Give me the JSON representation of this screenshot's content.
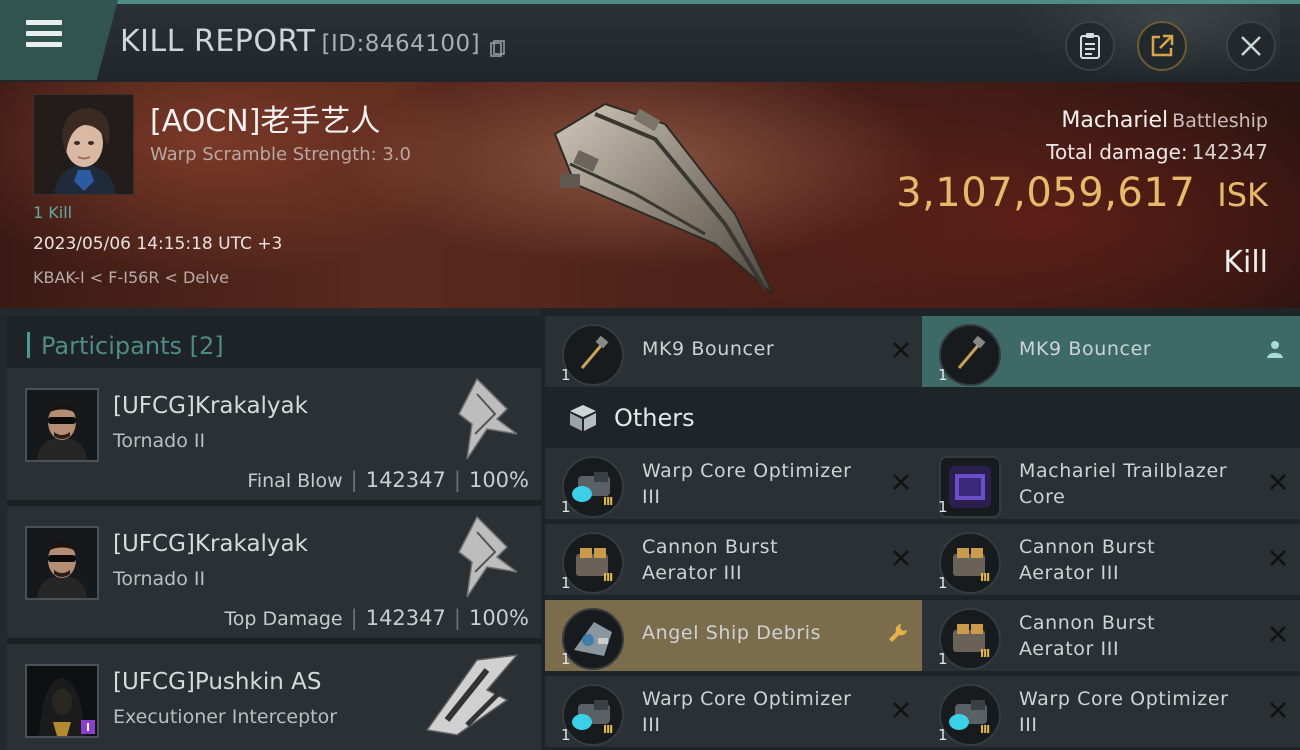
{
  "header": {
    "title": "KILL REPORT",
    "report_id": "[ID:8464100]"
  },
  "victim": {
    "name": "[AOCN]老手艺人",
    "warp_scramble": "Warp Scramble Strength: 3.0",
    "kill_count": "1 Kill",
    "timestamp": "2023/05/06 14:15:18 UTC +3",
    "location": "KBAK-I < F-I56R < Delve",
    "ship_name": "Machariel",
    "ship_class": "Battleship",
    "damage_label": "Total damage:",
    "damage_value": "142347",
    "isk_value": "3,107,059,617",
    "isk_unit": "ISK",
    "result": "Kill"
  },
  "participants": {
    "title": "Participants",
    "count": "[2]",
    "rows": [
      {
        "name": "[UFCG]Krakalyak",
        "ship": "Tornado II",
        "label": "Final Blow",
        "damage": "142347",
        "percent": "100%"
      },
      {
        "name": "[UFCG]Krakalyak",
        "ship": "Tornado II",
        "label": "Top Damage",
        "damage": "142347",
        "percent": "100%"
      },
      {
        "name": "[UFCG]Pushkin AS",
        "ship": "Executioner Interceptor",
        "label": "",
        "damage": "",
        "percent": ""
      }
    ]
  },
  "items": {
    "top_row": [
      {
        "name": "MK9  Bouncer",
        "qty": "1"
      },
      {
        "name": "MK9  Bouncer",
        "qty": "1"
      }
    ],
    "others_title": "Others",
    "grid": [
      {
        "name_line1": "Warp Core Optimizer",
        "name_line2": "III",
        "qty": "1"
      },
      {
        "name_line1": "Machariel Trailblazer",
        "name_line2": "Core",
        "qty": "1"
      },
      {
        "name_line1": "Cannon Burst",
        "name_line2": "Aerator III",
        "qty": "1"
      },
      {
        "name_line1": "Cannon Burst",
        "name_line2": "Aerator III",
        "qty": "1"
      },
      {
        "name_line1": "Angel Ship Debris",
        "name_line2": "",
        "qty": "1"
      },
      {
        "name_line1": "Cannon Burst",
        "name_line2": "Aerator III",
        "qty": "1"
      },
      {
        "name_line1": "Warp Core Optimizer",
        "name_line2": "III",
        "qty": "1"
      },
      {
        "name_line1": "Warp Core Optimizer",
        "name_line2": "III",
        "qty": "1"
      }
    ]
  },
  "colors": {
    "accent_teal": "#4f8c88",
    "isk_gold": "#e8b96a",
    "highlight_teal": "#3d6a67",
    "highlight_gold": "#7b6c4c"
  }
}
